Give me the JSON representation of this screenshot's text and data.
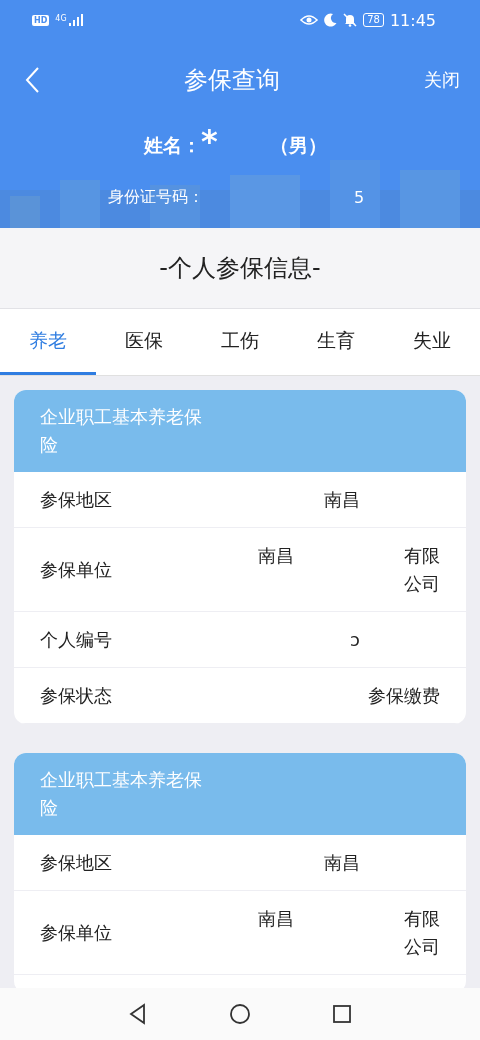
{
  "status_bar": {
    "network_badge": "HD",
    "network_type": "4G",
    "battery": "78",
    "time": "11:45"
  },
  "header": {
    "title": "参保查询",
    "close": "关闭",
    "name_label": "姓名：",
    "name_value": "*",
    "gender": "（男）",
    "id_label": "身份证号码：",
    "id_value": "5"
  },
  "section_title": "-个人参保信息-",
  "tabs": [
    {
      "label": "养老",
      "selected": true
    },
    {
      "label": "医保",
      "selected": false
    },
    {
      "label": "工伤",
      "selected": false
    },
    {
      "label": "生育",
      "selected": false
    },
    {
      "label": "失业",
      "selected": false
    }
  ],
  "cards": [
    {
      "title": "企业职工基本养老保险",
      "rows": [
        {
          "label": "参保地区",
          "values": [
            "南昌"
          ]
        },
        {
          "label": "参保单位",
          "values": [
            "南昌",
            "有限公司"
          ]
        },
        {
          "label": "个人编号",
          "values": [
            "ↄ"
          ]
        },
        {
          "label": "参保状态",
          "values": [
            "参保缴费"
          ]
        }
      ]
    },
    {
      "title": "企业职工基本养老保险",
      "rows": [
        {
          "label": "参保地区",
          "values": [
            "南昌"
          ]
        },
        {
          "label": "参保单位",
          "values": [
            "南昌",
            "有限公司"
          ]
        }
      ]
    }
  ]
}
